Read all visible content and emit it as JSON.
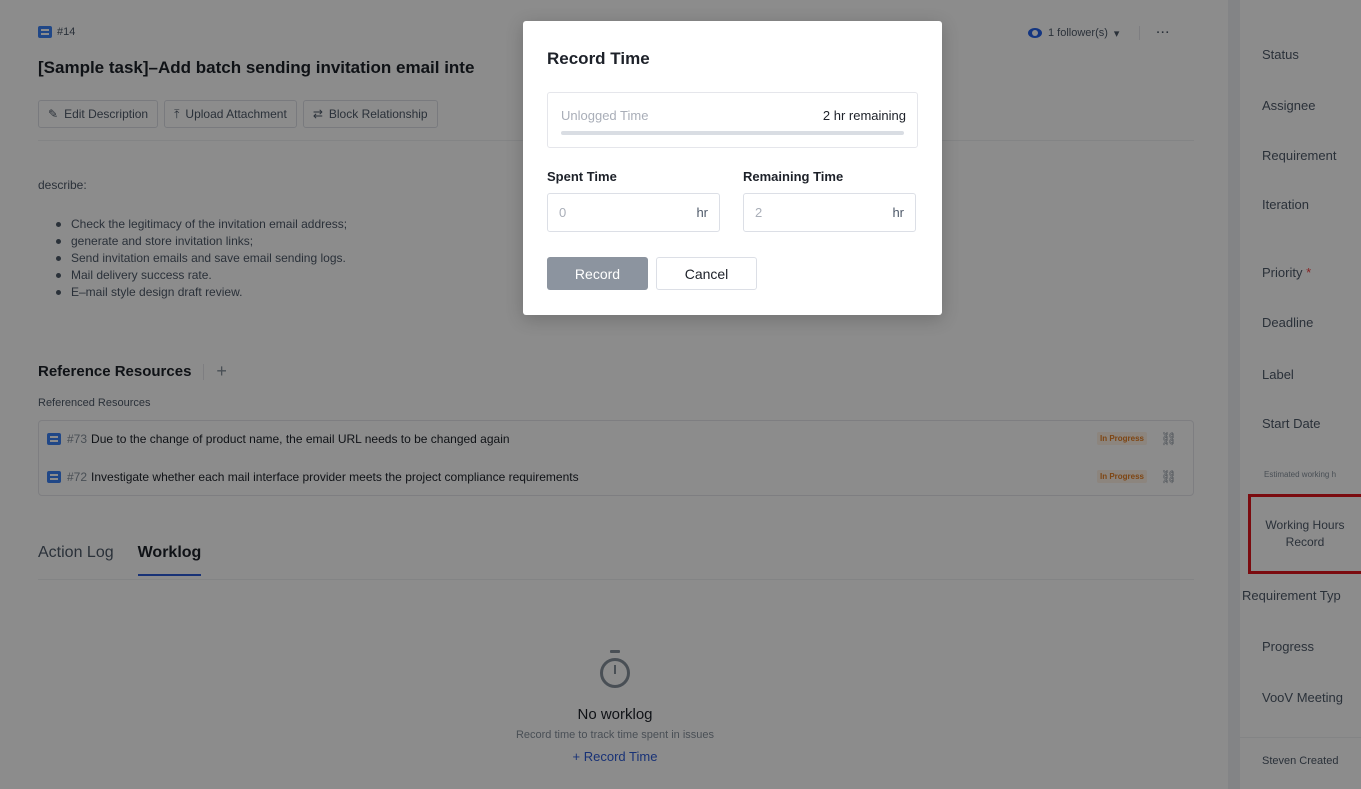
{
  "issue": {
    "id": "#14",
    "title": "[Sample task]–Add batch sending invitation email inte",
    "followers": "1 follower(s)",
    "follower_caret": "▾",
    "more": "···"
  },
  "toolbar": {
    "edit_description": "Edit Description",
    "upload_attachment": "Upload Attachment",
    "block_relationship": "Block Relationship"
  },
  "description": {
    "label": "describe:",
    "items": [
      "Check the legitimacy of the invitation email address;",
      "generate and store invitation links;",
      "Send invitation emails and save email sending logs.",
      "Mail delivery success rate.",
      "E–mail style design draft review."
    ]
  },
  "references": {
    "heading": "Reference Resources",
    "add": "+",
    "sub_heading": "Referenced Resources",
    "items": [
      {
        "number": "#73",
        "text": "Due to the change of product name, the email URL needs to be changed again",
        "status": "In Progress"
      },
      {
        "number": "#72",
        "text": "Investigate whether each mail interface provider meets the project compliance requirements",
        "status": "In Progress"
      }
    ]
  },
  "tabs": [
    {
      "label": "Action Log"
    },
    {
      "label": "Worklog"
    }
  ],
  "empty_state": {
    "title": "No worklog",
    "description": "Record time to track time spent in issues",
    "link": "+ Record Time"
  },
  "sidebar": {
    "status": "Status",
    "assignee": "Assignee",
    "requirement": "Requirement",
    "iteration": "Iteration",
    "priority": "Priority",
    "priority_required": "*",
    "deadline": "Deadline",
    "label": "Label",
    "start_date": "Start Date",
    "estimated": "Estimated working h",
    "working_hours_record": "Working Hours Record",
    "requirement_type": "Requirement Typ",
    "progress": "Progress",
    "voov": "VooV Meeting",
    "created": "Steven Created"
  },
  "modal": {
    "title": "Record Time",
    "unlogged_label": "Unlogged Time",
    "unlogged_value": "2 hr remaining",
    "unlogged_fraction": 0,
    "spent_label": "Spent Time",
    "spent_value": "0",
    "spent_unit": "hr",
    "remaining_label": "Remaining Time",
    "remaining_value": "2",
    "remaining_unit": "hr",
    "record_button": "Record",
    "cancel_button": "Cancel"
  },
  "colors": {
    "accent": "#2d5bd8",
    "status_in_progress": "#e67e22",
    "highlight_box": "#e0141c",
    "record_button_bg": "#8c949f"
  },
  "icons": {
    "task": "task-icon",
    "follower": "eye-icon",
    "edit": "pencil-icon",
    "upload": "upload-icon",
    "block": "block-relationship-icon",
    "unlink": "unlink-icon",
    "empty": "timer-icon"
  }
}
